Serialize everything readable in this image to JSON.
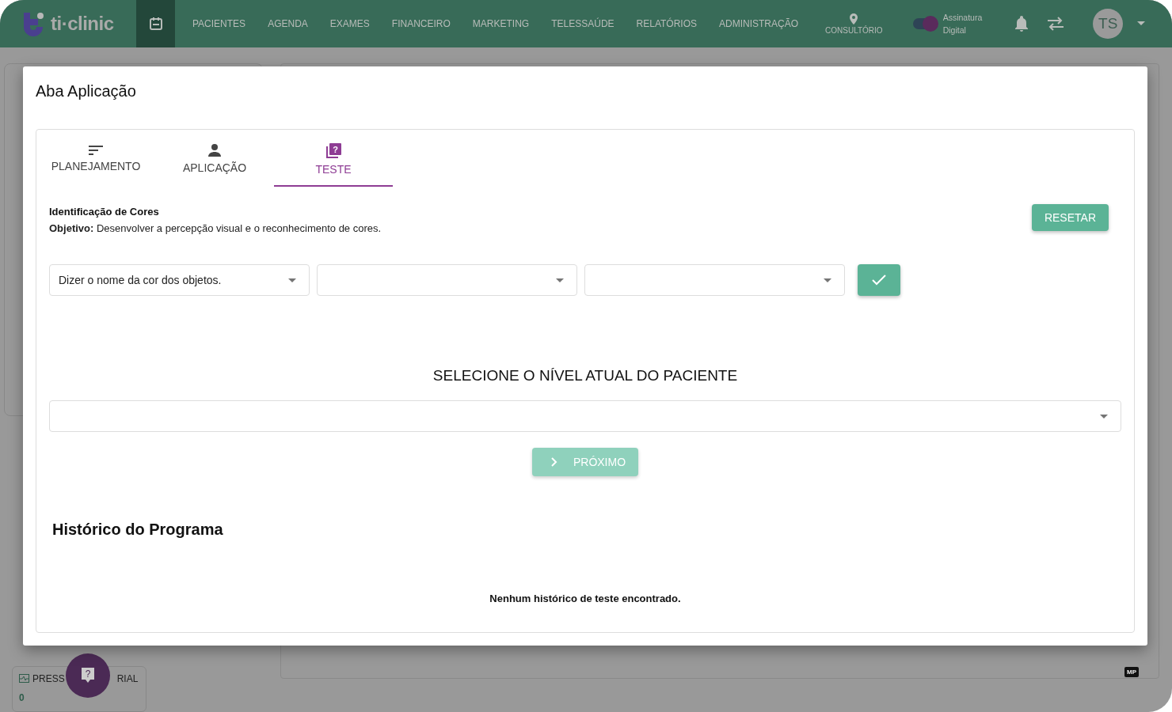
{
  "nav": {
    "logo": "ti·clinic",
    "items": [
      "PACIENTES",
      "AGENDA",
      "EXAMES",
      "FINANCEIRO",
      "MARKETING",
      "TELESSAÚDE",
      "RELATÓRIOS",
      "ADMINISTRAÇÃO"
    ],
    "location": "CONSULTÓRIO",
    "signature": {
      "line_1": "Assinatura",
      "line_2": "Digital",
      "on": true
    },
    "avatar": "TS"
  },
  "background": {
    "card_label_parts": [
      "PRESS",
      "RIAL"
    ],
    "card_value": "0",
    "badge": "MP"
  },
  "help_button": {
    "mark": "?"
  },
  "modal": {
    "title": "Aba Aplicação",
    "tabs": [
      {
        "label": "PLANEJAMENTO",
        "selected": false
      },
      {
        "label": "APLICAÇÃO",
        "selected": false
      },
      {
        "label": "TESTE",
        "icon_mark": "?",
        "selected": true
      }
    ],
    "activity_title": "Identificação de Cores",
    "objective": "**Objetivo:** Desenvolver a percepção visual e o reconhecimento de cores.",
    "reset_button": "RESETAR",
    "selects": [
      {
        "kind": "filled",
        "value": "Dizer o nome da cor dos objetos."
      },
      {
        "kind": "empty"
      },
      {
        "kind": "empty"
      }
    ],
    "level_heading": "SELECIONE O NÍVEL ATUAL DO PACIENTE",
    "next_button": {
      "label": "PRÓXIMO",
      "disabled": true
    },
    "history_title": "Histórico do Programa",
    "history_empty": "Nenhum histórico de teste encontrado."
  }
}
